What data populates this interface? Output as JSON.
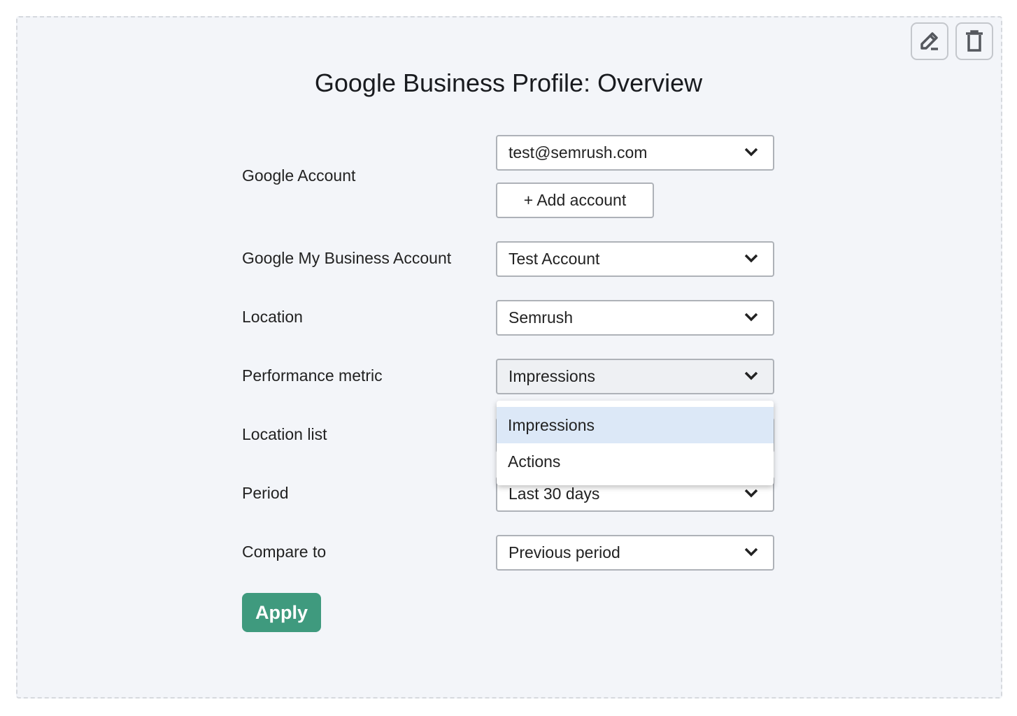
{
  "title": "Google Business Profile: Overview",
  "icons": {
    "edit": "pencil-icon",
    "delete": "trash-icon"
  },
  "fields": [
    {
      "label": "Google Account",
      "value": "test@semrush.com"
    },
    {
      "label": "Google My Business Account",
      "value": "Test Account"
    },
    {
      "label": "Location",
      "value": "Semrush"
    },
    {
      "label": "Performance metric",
      "value": "Impressions"
    },
    {
      "label": "Location list",
      "value": ""
    },
    {
      "label": "Period",
      "value": "Last 30 days"
    },
    {
      "label": "Compare to",
      "value": "Previous period"
    }
  ],
  "add_account_label": "+ Add account",
  "metric_options": [
    {
      "label": "Impressions",
      "highlighted": true
    },
    {
      "label": "Actions",
      "highlighted": false
    }
  ],
  "apply_label": "Apply",
  "colors": {
    "accent": "#3f9a7e",
    "highlight": "#dce8f7",
    "card_bg": "#f3f5f9"
  }
}
